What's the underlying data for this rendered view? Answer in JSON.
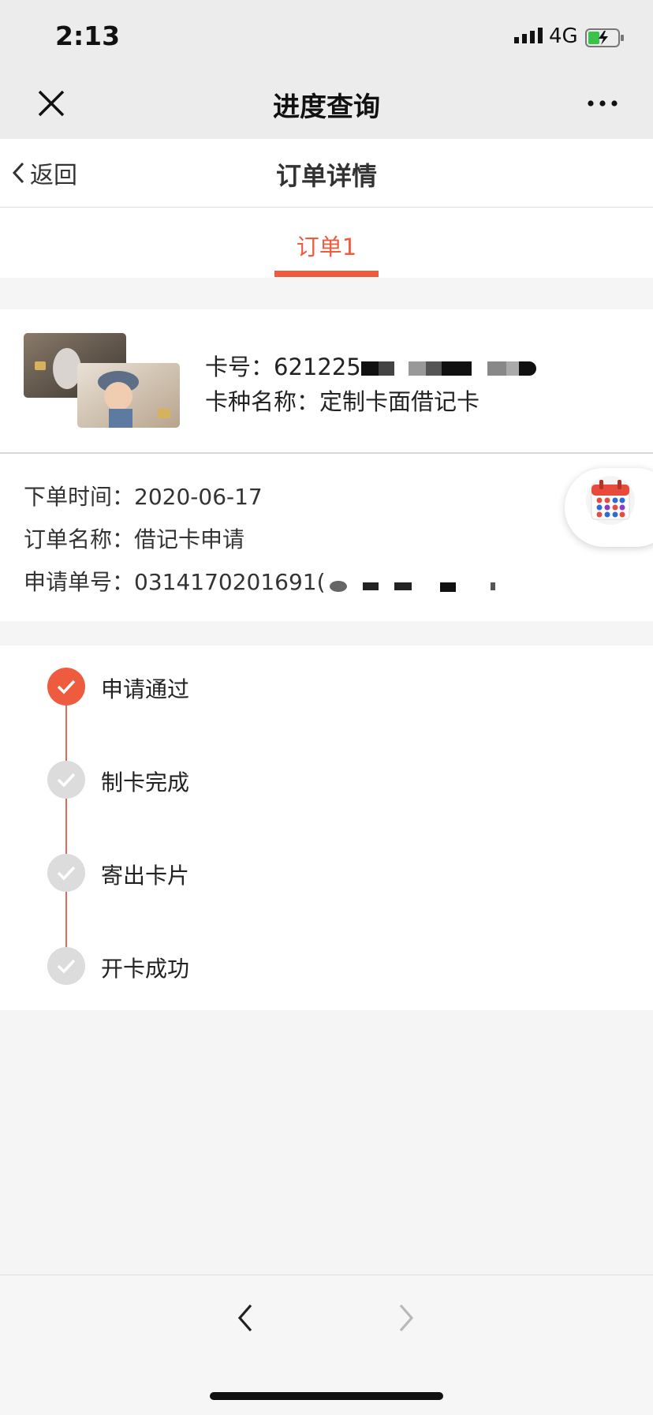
{
  "status_bar": {
    "time": "2:13",
    "network": "4G"
  },
  "wechat_nav": {
    "title": "进度查询",
    "close_icon": "close-icon",
    "more_icon": "more-icon"
  },
  "page_header": {
    "back_label": "返回",
    "title": "订单详情"
  },
  "tabs": [
    {
      "label": "订单1",
      "active": true
    }
  ],
  "card": {
    "number_label": "卡号：",
    "number_visible": "621225",
    "type_label": "卡种名称：",
    "type_value": "定制卡面借记卡"
  },
  "order": {
    "time_label": "下单时间：",
    "time_value": "2020-06-17",
    "name_label": "订单名称：",
    "name_value": "借记卡申请",
    "id_label": "申请单号：",
    "id_visible": "0314170201691("
  },
  "progress": [
    {
      "label": "申请通过",
      "done": true
    },
    {
      "label": "制卡完成",
      "done": false
    },
    {
      "label": "寄出卡片",
      "done": false
    },
    {
      "label": "开卡成功",
      "done": false
    }
  ],
  "colors": {
    "accent": "#ef5b3f",
    "inactive_step": "#dcdcdc"
  }
}
